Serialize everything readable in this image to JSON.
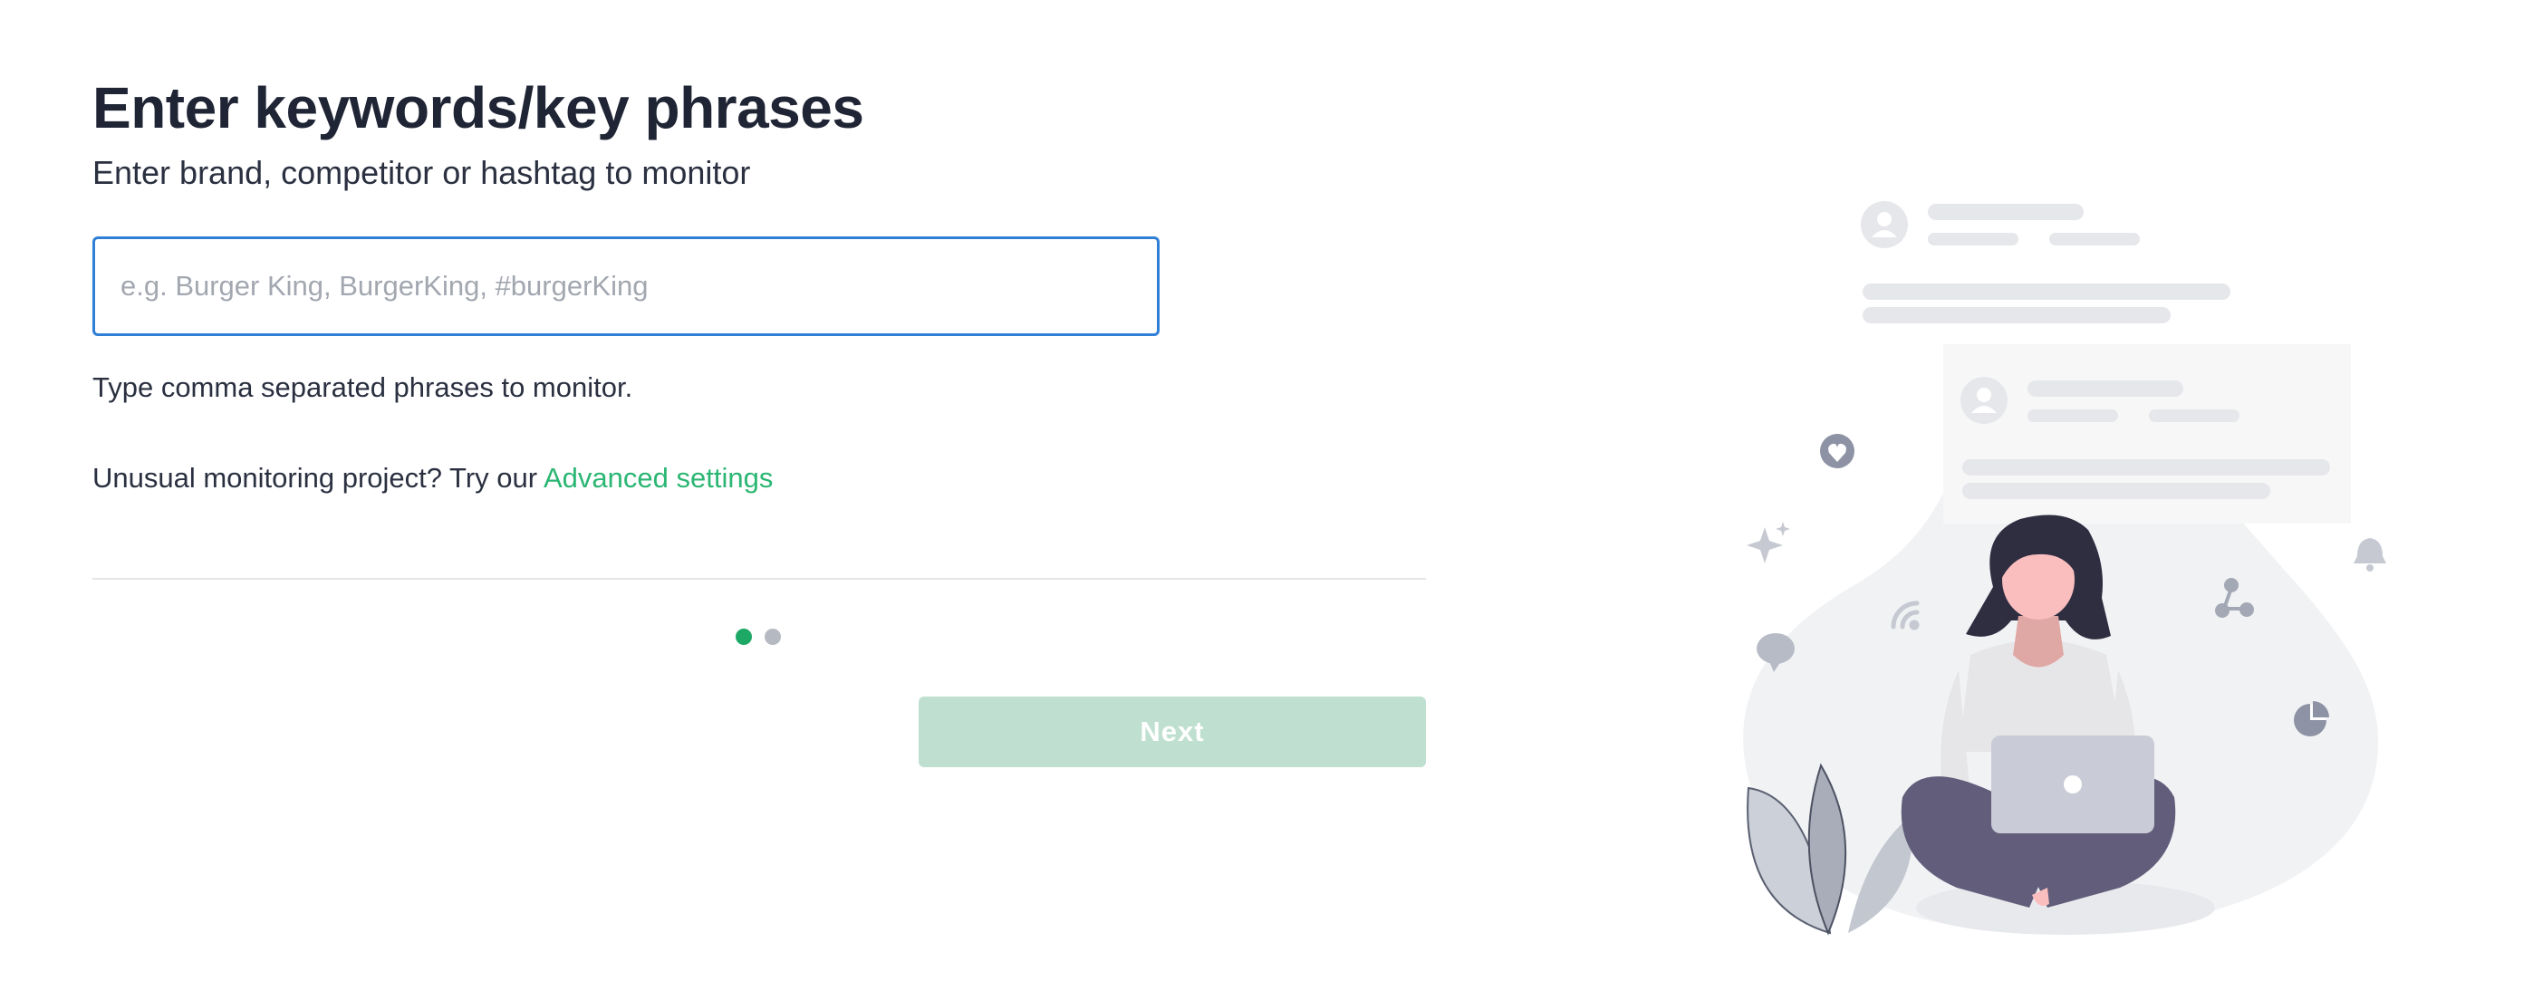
{
  "form": {
    "title": "Enter keywords/key phrases",
    "subtitle": "Enter brand, competitor or hashtag to monitor",
    "keywords_input": {
      "value": "",
      "placeholder": "e.g. Burger King, BurgerKing, #burgerKing"
    },
    "hint": "Type comma separated phrases to monitor.",
    "advanced_prefix": "Unusual monitoring project? Try our",
    "advanced_link": "Advanced settings"
  },
  "pager": {
    "current_step": 1,
    "total_steps": 2
  },
  "actions": {
    "next_label": "Next"
  },
  "colors": {
    "accent_green": "#2bb673",
    "active_dot": "#1ea866",
    "input_border": "#2f7fd6",
    "next_button_disabled": "#bfe0d1"
  },
  "illustration": {
    "icons": [
      "user-icon",
      "heart-bubble-icon",
      "sparkles-icon",
      "wifi-icon",
      "chat-bubble-icon",
      "share-icon",
      "bell-icon",
      "pie-chart-icon",
      "laptop-icon"
    ]
  }
}
